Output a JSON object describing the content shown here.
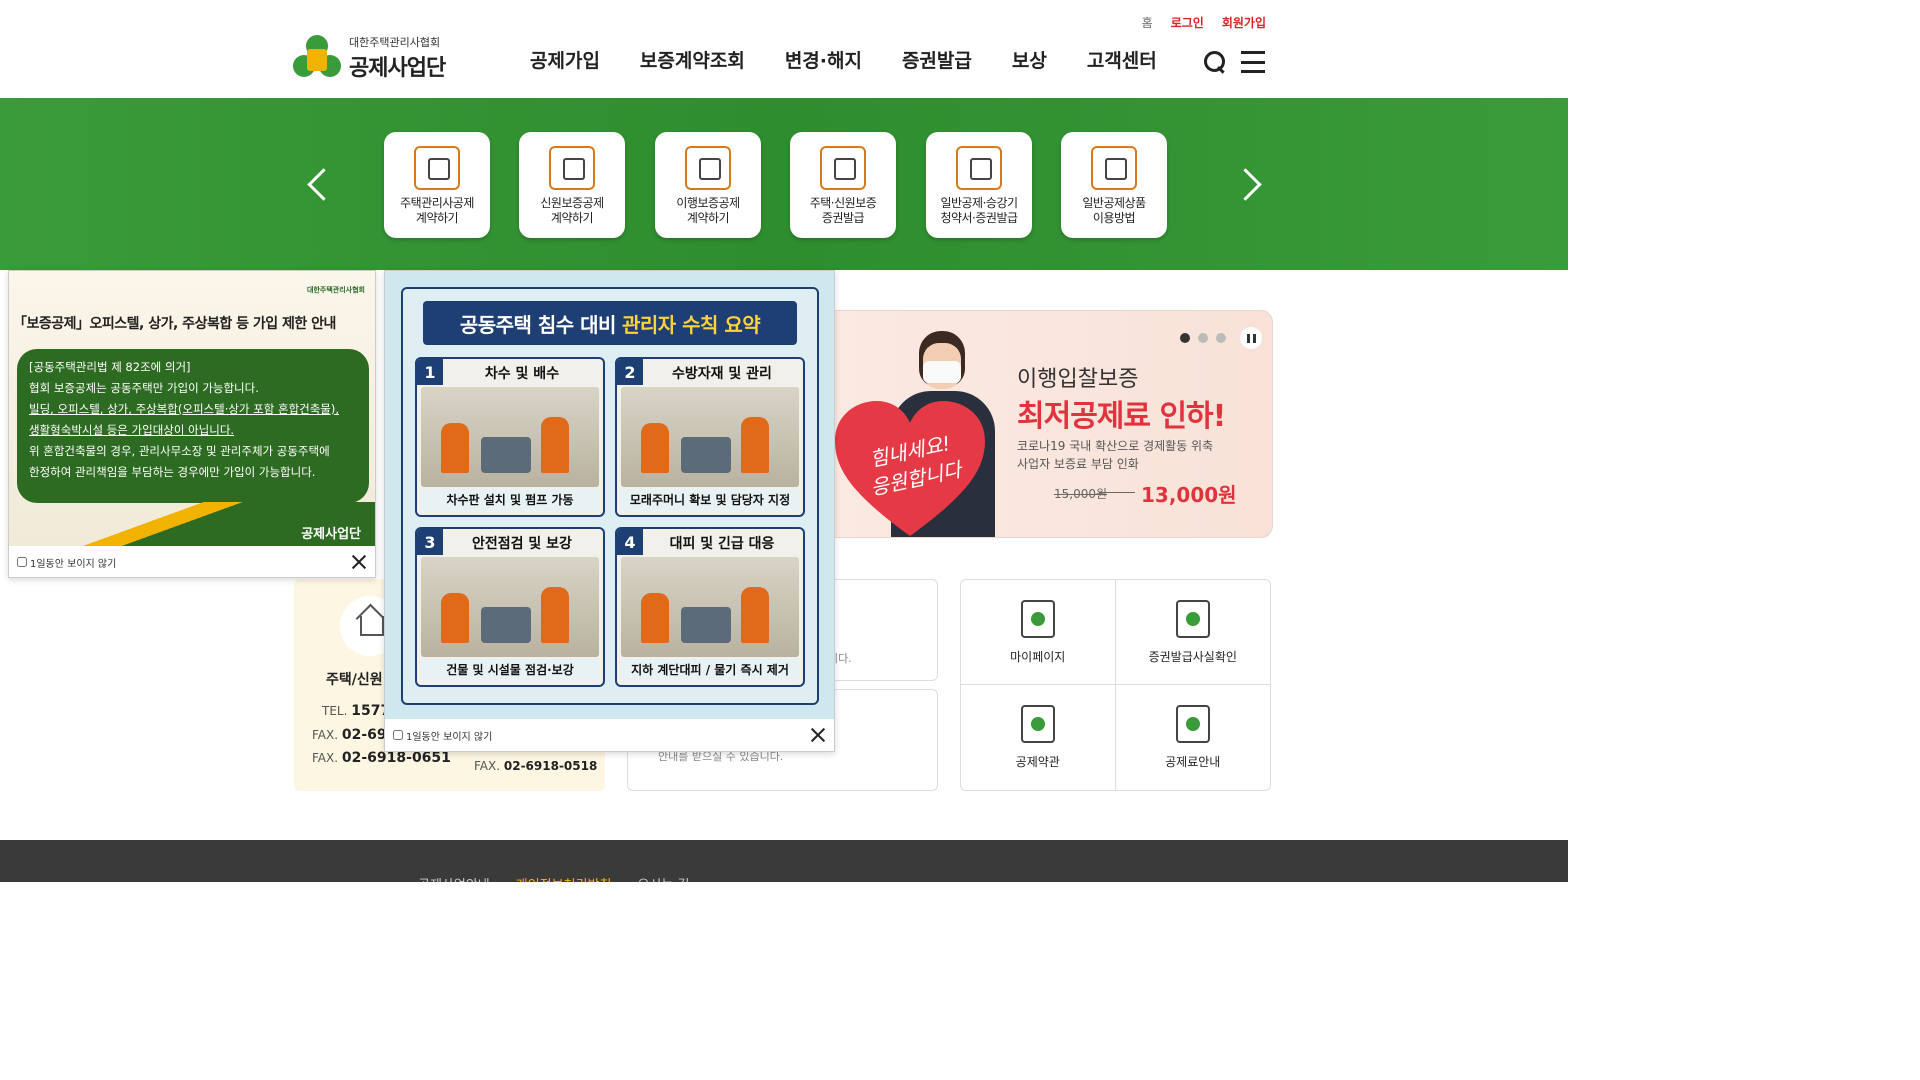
{
  "header": {
    "util": {
      "home": "홈",
      "login": "로그인",
      "join": "회원가입"
    },
    "logo": {
      "sub": "대한주택관리사협회",
      "main": "공제사업단"
    },
    "nav": [
      "공제가입",
      "보증계약조회",
      "변경·해지",
      "증권발급",
      "보상",
      "고객센터"
    ]
  },
  "quick": [
    {
      "label": "주택관리사공제\n계약하기",
      "icon": "hand-house-icon"
    },
    {
      "label": "신원보증공제\n계약하기",
      "icon": "people-check-icon"
    },
    {
      "label": "이행보증공제\n계약하기",
      "icon": "percent-hand-icon"
    },
    {
      "label": "주택·신원보증\n증권발급",
      "icon": "house-doc-upload-icon"
    },
    {
      "label": "일반공제·승강기\n청약서·증권발급",
      "icon": "doc-upload-icon"
    },
    {
      "label": "일반공제상품\n이용방법",
      "icon": "doc-search-icon"
    }
  ],
  "banner": {
    "heart_text": "힘내세요!\n응원합니다",
    "title1": "이행입찰보증",
    "title2": "최저공제료 인하!",
    "desc": "코로나19 국내 확산으로 경제활동 위축\n사업자 보증료 부담 인화",
    "old_price": "15,000원",
    "new_price": "13,000원",
    "active_slide": 1,
    "slide_count": 3
  },
  "contact": {
    "title": "주택/신원",
    "tel_label": "TEL.",
    "tel": "1577-",
    "fax_label": "FAX.",
    "fax1": "02-691",
    "fax2": "02-6918-0651",
    "fax3": "02-6918-0518"
  },
  "middle": {
    "box1_text": "니다.",
    "box2_text": "안내를 받으실 수 있습니다."
  },
  "shortcuts": [
    {
      "label": "마이페이지",
      "icon": "person-tie-icon"
    },
    {
      "label": "증권발급사실확인",
      "icon": "magnifier-doc-icon"
    },
    {
      "label": "공제약관",
      "icon": "certificate-doc-icon"
    },
    {
      "label": "공제료안내",
      "icon": "wallet-icon"
    }
  ],
  "footer": {
    "links": [
      "공제사업안내",
      "개인정보처리방침",
      "오시는 길"
    ]
  },
  "popup1": {
    "logo": "대한주택관리사협회",
    "title": "「보증공제」오피스텔, 상가, 주상복합 등 가입 제한 안내",
    "line1": "[공동주택관리법 제 82조에 의거]",
    "line2": "협회 보증공제는 공동주택만 가입이 가능합니다.",
    "line3": "빌딩, 오피스텔, 상가, 주상복합(오피스텔·상가 포함 혼합건축물),",
    "line4": "생활형숙박시설 등은 가입대상이 아닙니다.",
    "line5": "위 혼합건축물의 경우, 관리사무소장 및 관리주체가 공동주택에",
    "line6": "한정하여 관리책임을 부담하는 경우에만 가입이 가능합니다.",
    "brand": "공제사업단",
    "checkbox": "1일동안 보이지 않기"
  },
  "popup2": {
    "title_a": "공동주택 침수 대비",
    "title_b": "관리자 수칙 요약",
    "panels": [
      {
        "num": "1",
        "title": "차수 및 배수",
        "caption": "차수판 설치 및 펌프 가동"
      },
      {
        "num": "2",
        "title": "수방자재 및 관리",
        "caption": "모래주머니 확보 및 담당자 지정"
      },
      {
        "num": "3",
        "title": "안전점검 및 보강",
        "caption": "건물 및 시설물 점검·보강"
      },
      {
        "num": "4",
        "title": "대피 및 긴급 대응",
        "caption": "지하 계단대피 / 물기 즉시 제거"
      }
    ],
    "checkbox": "1일동안 보이지 않기"
  },
  "colors": {
    "green": "#3a9b3a",
    "red": "#e0333d",
    "navy": "#1d3f73",
    "yellow": "#f2b300"
  }
}
